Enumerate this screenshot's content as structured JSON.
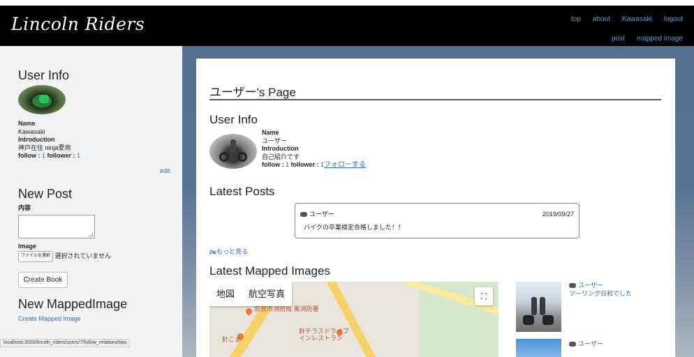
{
  "header": {
    "brand": "Lincoln Riders",
    "nav_row1": [
      "top",
      "about",
      "Kawasaki",
      "logout"
    ],
    "nav_row2": [
      "post",
      "mapped image"
    ],
    "accent_color": "#4aa0e8"
  },
  "sidebar": {
    "user_info_heading": "User Info",
    "name_label": "Name",
    "name_value": "Kawasaki",
    "intro_label": "Introduction",
    "intro_value": "神戸在住 ninja愛用",
    "follow_label": "follow : ",
    "follow_count": "1",
    "follower_label": " follower : ",
    "follower_count": "1",
    "edit_link": "edit",
    "new_post_heading": "New Post",
    "content_label": "内容",
    "image_label": "Image",
    "file_button": "ファイルを選択",
    "file_status": "選択されていません",
    "create_button": "Create Book",
    "new_mapped_heading": "New MappedImage",
    "create_mapped_link": "Create Mapped Image"
  },
  "main": {
    "page_title": "ユーザー's Page",
    "user_info_heading": "User Info",
    "name_label": "Name",
    "name_value": "ユーザー",
    "intro_label": "Introduction",
    "intro_value": "自己紹介です",
    "follow_label": "follow : ",
    "follow_count": "1",
    "follower_label": " follower : ",
    "follower_count": "1",
    "follow_action": "フォローする",
    "latest_posts_heading": "Latest Posts",
    "post": {
      "author": "ユーザー",
      "date": "2019/09/27",
      "body": "バイクの卒業検定合格しました！！"
    },
    "more_link": "もっと見る",
    "latest_mapped_heading": "Latest Mapped Images",
    "map": {
      "tab_map": "地図",
      "tab_satellite": "航空写真",
      "fullscreen_icon": "fullscreen-icon",
      "label_fire": "奈良市消防局 東消防署",
      "label_restaurant": "針テラスドライブ インレストラン",
      "label_hari": "針こま"
    },
    "mapped_items": [
      {
        "author": "ユーザー",
        "caption": "ツーリング日和でした"
      },
      {
        "author": "ユーザー",
        "caption": ""
      }
    ]
  },
  "statusbar": {
    "url": "localhost:3000/lincoln_riders/users/7/follow_relationships"
  }
}
